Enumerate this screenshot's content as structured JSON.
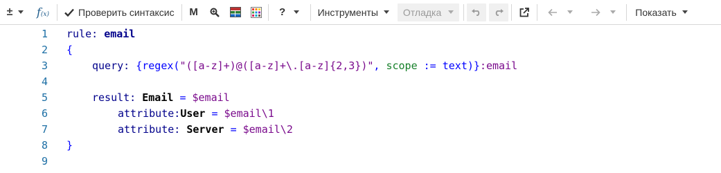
{
  "toolbar": {
    "plusminus_glyph": "±",
    "fx_glyph": "f",
    "fx_sub": "(x)",
    "check_label": "Проверить синтаксис",
    "m_label": "M",
    "help_glyph": "?",
    "tools_label": "Инструменты",
    "debug_label": "Отладка",
    "show_label": "Показать",
    "icons": [
      "plusminus-icon",
      "function-icon",
      "checkmark-icon",
      "bold-m-icon",
      "zoom-icon",
      "grid-image-icon",
      "color-palette-icon",
      "help-icon",
      "undo-icon",
      "redo-icon",
      "open-external-icon",
      "back-arrow-icon",
      "forward-arrow-icon"
    ]
  },
  "editor": {
    "line_numbers": [
      "1",
      "2",
      "3",
      "4",
      "5",
      "6",
      "7",
      "8",
      "9"
    ],
    "l1_kw": "rule:",
    "l1_name": "email",
    "l2": "{",
    "l3_kw": "query:",
    "l3_brace": "{",
    "l3_regex": "regex(",
    "l3_str": "\"([a-z]+)@([a-z]+\\.[a-z]{2,3})\"",
    "l3_comma": ",",
    "l3_scope": "scope",
    "l3_assign": ":=",
    "l3_text": "text)",
    "l3_close": "}",
    "l3_var": ":email",
    "l5_kw": "result:",
    "l5_type": "Email",
    "l5_eq": "=",
    "l5_var": "$email",
    "l6_kw": "attribute:",
    "l6_name": "User",
    "l6_eq": "=",
    "l6_var": "$email\\1",
    "l7_kw": "attribute:",
    "l7_name": "Server",
    "l7_eq": "=",
    "l7_var": "$email\\2",
    "l8": "}"
  },
  "colors": {
    "line_number": "#1d6fa5",
    "keyword": "#00008b",
    "brace": "#0000ff",
    "variable": "#7a0a8c",
    "string": "#16802a"
  }
}
